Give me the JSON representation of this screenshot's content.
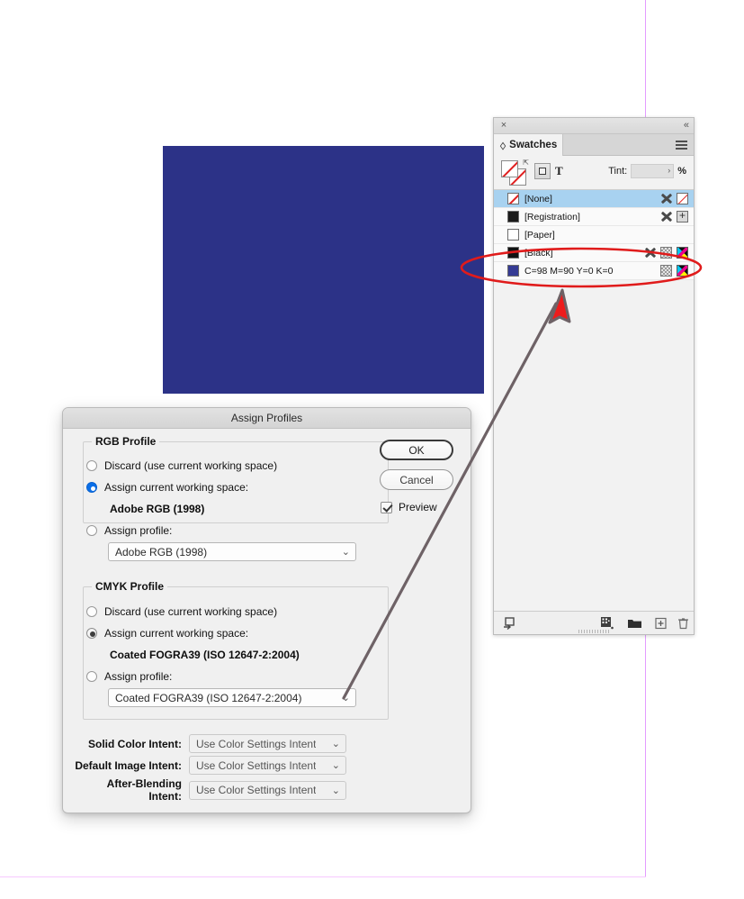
{
  "swatches_panel": {
    "title": "Swatches",
    "close_icon": "×",
    "collapse_icon": "«",
    "menu_icon": "panel-menu-icon",
    "toolbar": {
      "fill_stroke_icon": "fill-stroke-none-icon",
      "swap_icon": "⇱",
      "apply_to_object_icon": "apply-to-frame-icon",
      "apply_to_text_label": "T",
      "tint_label": "Tint:",
      "tint_value": "",
      "tint_chevron": "›",
      "tint_percent": "%"
    },
    "swatch_rows": [
      {
        "name": "[None]",
        "chip": "none",
        "chip_color": "#ffffff",
        "selected": true,
        "icons": [
          "swatch-x-icon",
          "none-swatch-icon"
        ]
      },
      {
        "name": "[Registration]",
        "chip": "solid",
        "chip_color": "#1a1a1a",
        "selected": false,
        "icons": [
          "swatch-x-icon",
          "registration-icon"
        ]
      },
      {
        "name": "[Paper]",
        "chip": "solid",
        "chip_color": "#ffffff",
        "selected": false,
        "icons": []
      },
      {
        "name": "[Black]",
        "chip": "solid",
        "chip_color": "#111111",
        "selected": false,
        "icons": [
          "swatch-x-icon",
          "tint-icon",
          "cmyk-icon"
        ]
      },
      {
        "name": "C=98 M=90 Y=0 K=0",
        "chip": "solid",
        "chip_color": "#353b94",
        "selected": false,
        "icons": [
          "tint-icon",
          "cmyk-icon"
        ]
      }
    ],
    "footer_icons": [
      "show-all-swatches-icon",
      "new-color-group-icon",
      "new-swatch-group-folder-icon",
      "new-swatch-icon",
      "delete-swatch-icon"
    ]
  },
  "artwork": {
    "rectangle_color": "#2c3287"
  },
  "page_guides": {
    "color": "#e39bff"
  },
  "dialog": {
    "title": "Assign Profiles",
    "buttons": {
      "ok": "OK",
      "cancel": "Cancel"
    },
    "preview": {
      "label": "Preview",
      "checked": true
    },
    "rgb_section": {
      "legend": "RGB Profile",
      "option_discard": "Discard (use current working space)",
      "option_assign_working": "Assign current working space:",
      "working_space_value": "Adobe RGB (1998)",
      "option_assign_profile": "Assign profile:",
      "profile_select_value": "Adobe RGB (1998)",
      "selected_option": "assign_working"
    },
    "cmyk_section": {
      "legend": "CMYK Profile",
      "option_discard": "Discard (use current working space)",
      "option_assign_working": "Assign current working space:",
      "working_space_value": "Coated FOGRA39 (ISO 12647-2:2004)",
      "option_assign_profile": "Assign profile:",
      "profile_select_value": "Coated FOGRA39 (ISO 12647-2:2004)",
      "selected_option": "assign_working"
    },
    "intents": [
      {
        "label": "Solid Color Intent:",
        "value": "Use Color Settings Intent"
      },
      {
        "label": "Default Image Intent:",
        "value": "Use Color Settings Intent"
      },
      {
        "label": "After-Blending Intent:",
        "value": "Use Color Settings Intent"
      }
    ]
  },
  "annotations": {
    "ellipse_color": "#e01b1b",
    "arrow_outline_color": "#6e6266",
    "arrow_head_color": "#ee1c1c"
  }
}
